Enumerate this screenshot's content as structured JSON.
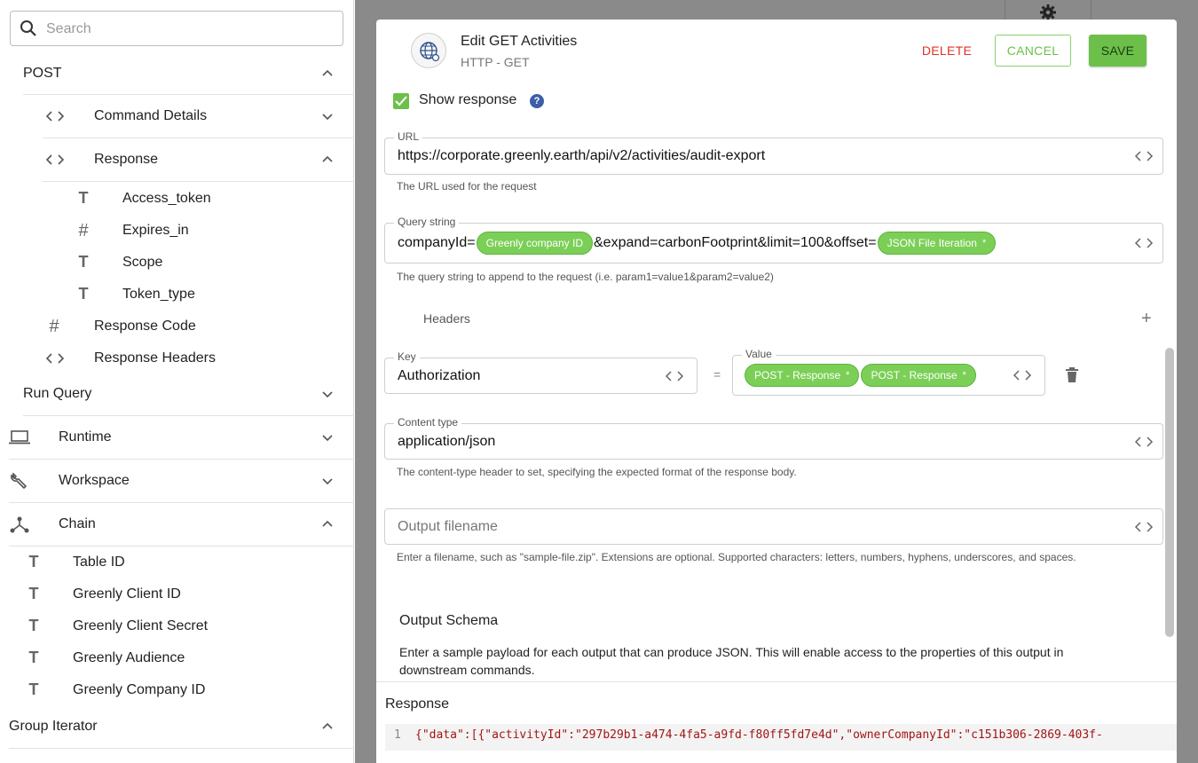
{
  "sidebar": {
    "search_placeholder": "Search",
    "post": {
      "label": "POST"
    },
    "command_details": {
      "label": "Command Details"
    },
    "response": {
      "label": "Response"
    },
    "response_fields": [
      {
        "type": "T",
        "label": "Access_token"
      },
      {
        "type": "#",
        "label": "Expires_in"
      },
      {
        "type": "T",
        "label": "Scope"
      },
      {
        "type": "T",
        "label": "Token_type"
      }
    ],
    "response_code": {
      "type": "#",
      "label": "Response Code"
    },
    "response_headers": {
      "label": "Response Headers"
    },
    "run_query": {
      "label": "Run Query"
    },
    "runtime": {
      "label": "Runtime"
    },
    "workspace": {
      "label": "Workspace"
    },
    "chain": {
      "label": "Chain"
    },
    "chain_items": [
      {
        "type": "T",
        "label": "Table ID"
      },
      {
        "type": "T",
        "label": "Greenly Client ID"
      },
      {
        "type": "T",
        "label": "Greenly Client Secret"
      },
      {
        "type": "T",
        "label": "Greenly Audience"
      },
      {
        "type": "T",
        "label": "Greenly Company ID"
      }
    ],
    "group_iterator": {
      "label": "Group Iterator"
    }
  },
  "modal": {
    "title": "Edit GET Activities",
    "subtitle": "HTTP - GET",
    "delete_label": "DELETE",
    "cancel_label": "CANCEL",
    "save_label": "SAVE",
    "show_response_label": "Show response",
    "help_glyph": "?",
    "url": {
      "label": "URL",
      "value": "https://corporate.greenly.earth/api/v2/activities/audit-export",
      "helper": "The URL used for the request"
    },
    "query": {
      "label": "Query string",
      "part1": "companyId=",
      "pill1": "Greenly company ID",
      "part2": "&expand=carbonFootprint&limit=100&offset=",
      "pill2": "JSON File Iteration",
      "pill2_mark": "*",
      "helper": "The query string to append to the request (i.e. param1=value1&param2=value2)"
    },
    "headers": {
      "title": "Headers",
      "add_glyph": "+",
      "key_label": "Key",
      "key_value": "Authorization",
      "equals": "=",
      "value_label": "Value",
      "value_pill1": "POST - Response",
      "value_pill2": "POST - Response",
      "pill_mark": "*"
    },
    "content_type": {
      "label": "Content type",
      "value": "application/json",
      "helper": "The content-type header to set, specifying the expected format of the response body."
    },
    "output_filename": {
      "placeholder": "Output filename",
      "helper": "Enter a filename, such as \"sample-file.zip\". Extensions are optional. Supported characters: letters, numbers, hyphens, underscores, and spaces."
    },
    "output_schema": {
      "title": "Output Schema",
      "description": "Enter a sample payload for each output that can produce JSON. This will enable access to the properties of this output in downstream commands."
    },
    "response": {
      "title": "Response",
      "line_number": "1",
      "code": "{\"data\":[{\"activityId\":\"297b29b1-a474-4fa5-a9fd-f80ff5fd7e4d\",\"ownerCompanyId\":\"c151b306-2869-403f-"
    }
  },
  "colors": {
    "accent": "#6cc04a",
    "danger": "#e0302b",
    "help": "#3b5fa8"
  }
}
